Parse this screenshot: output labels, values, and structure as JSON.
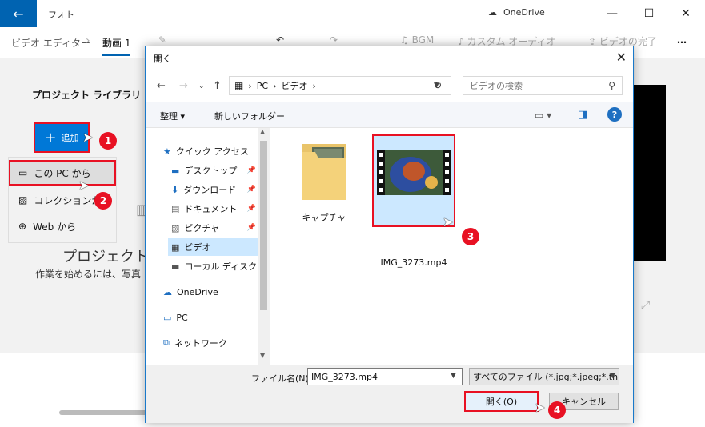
{
  "app": {
    "title": "フォト",
    "onedrive": "OneDrive",
    "back_icon": "←",
    "minimize": "—",
    "maximize": "☐",
    "close": "✕"
  },
  "toolbar": {
    "crumb_editor": "ビデオ エディター",
    "crumb_current": "動画 1",
    "bgm": "BGM",
    "custom_audio": "カスタム オーディオ",
    "finish_video": "ビデオの完了",
    "more": "…"
  },
  "library": {
    "title": "プロジェクト ライブラリ",
    "add_label": "追加",
    "menu": [
      "この PC から",
      "コレクションから",
      "Web から"
    ],
    "project_title": "プロジェクト ラ",
    "project_sub": "作業を始めるには、写真"
  },
  "steps": [
    "1",
    "2",
    "3",
    "4"
  ],
  "dialog": {
    "title": "開く",
    "address": [
      "PC",
      "ビデオ"
    ],
    "search_placeholder": "ビデオの検索",
    "organize": "整理 ▾",
    "new_folder": "新しいフォルダー",
    "help": "?",
    "nav_items": [
      {
        "label": "クイック アクセス",
        "icon": "star-icon",
        "pinned": false
      },
      {
        "label": "デスクトップ",
        "icon": "desktop-icon",
        "pinned": true
      },
      {
        "label": "ダウンロード",
        "icon": "download-icon",
        "pinned": true
      },
      {
        "label": "ドキュメント",
        "icon": "document-icon",
        "pinned": true
      },
      {
        "label": "ピクチャ",
        "icon": "picture-icon",
        "pinned": true
      },
      {
        "label": "ビデオ",
        "icon": "video-icon",
        "pinned": false
      },
      {
        "label": "ローカル ディスク (C",
        "icon": "disk-icon",
        "pinned": false
      },
      {
        "label": "OneDrive",
        "icon": "cloud-icon",
        "pinned": false
      },
      {
        "label": "PC",
        "icon": "pc-icon",
        "pinned": false
      },
      {
        "label": "ネットワーク",
        "icon": "network-icon",
        "pinned": false
      }
    ],
    "files": [
      {
        "name": "キャプチャ",
        "type": "folder"
      },
      {
        "name": "IMG_3273.mp4",
        "type": "video"
      }
    ],
    "filename_label": "ファイル名(N):",
    "filename_value": "IMG_3273.mp4",
    "filetype": "すべてのファイル (*.jpg;*.jpeg;*.thu",
    "open_label": "開く(O)",
    "cancel_label": "キャンセル"
  },
  "colors": {
    "accent": "#0078d7",
    "highlight": "#e81123",
    "selection": "#cce8ff"
  }
}
